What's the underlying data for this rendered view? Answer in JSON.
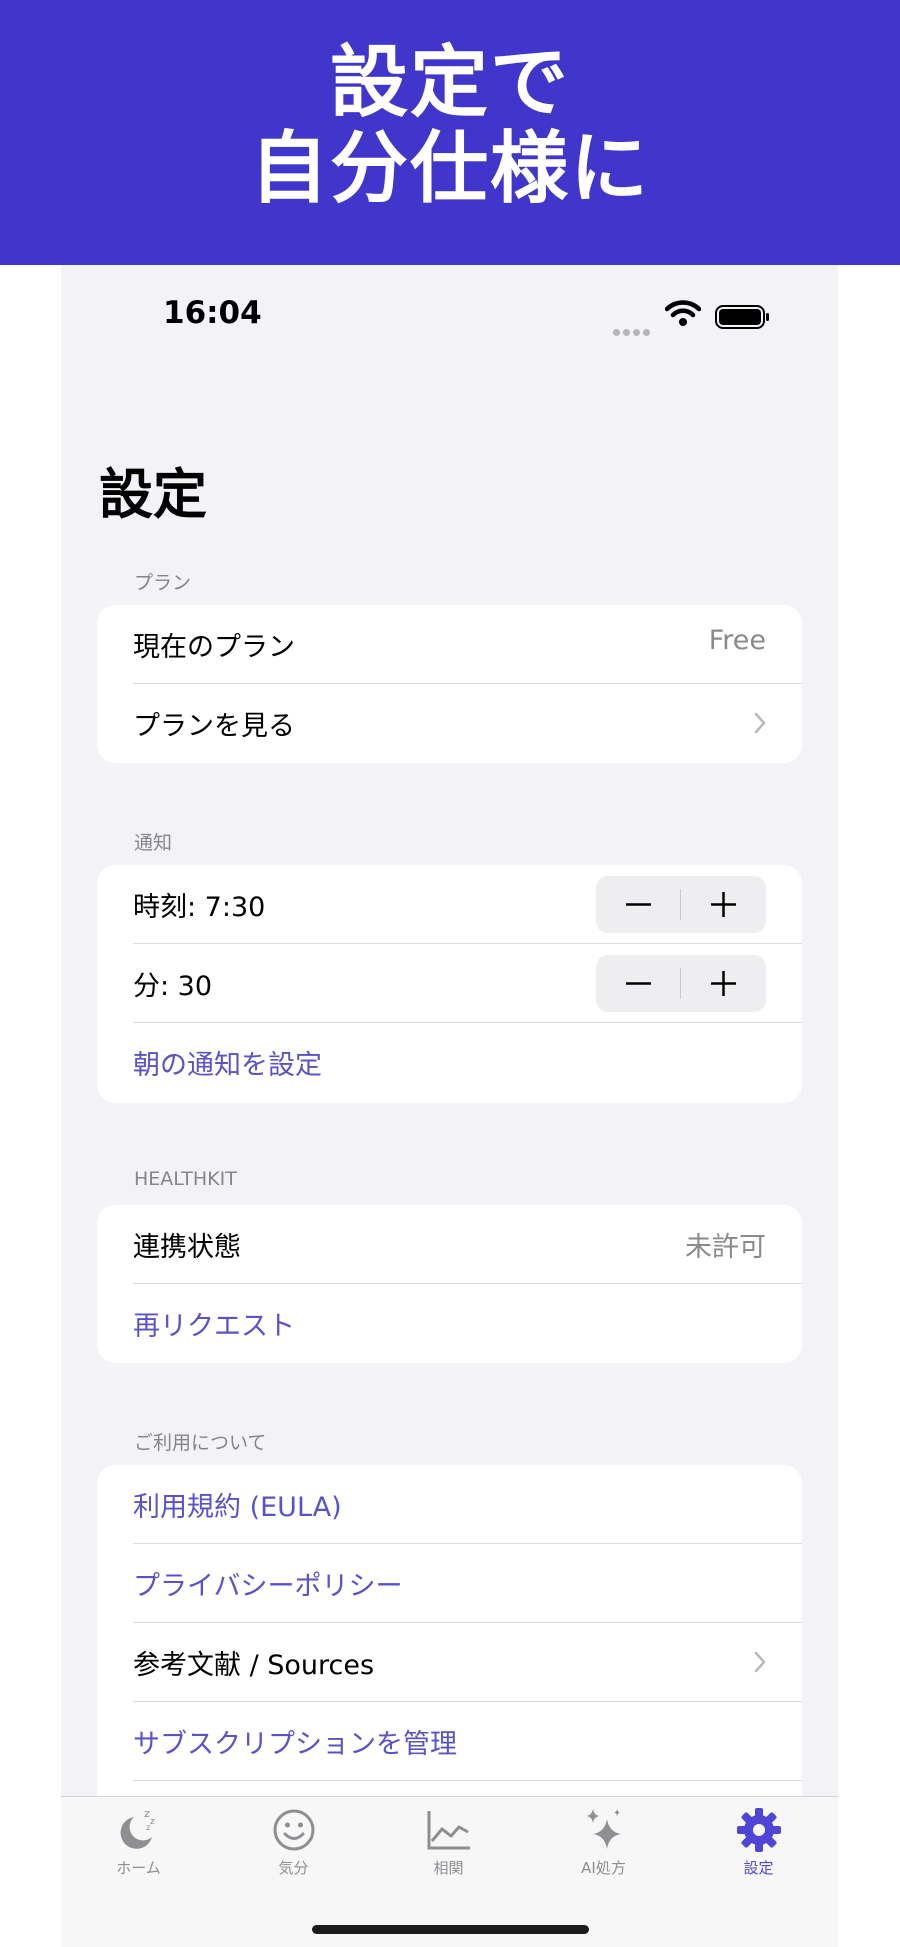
{
  "banner": {
    "line1": "設定で",
    "line2": "自分仕様に"
  },
  "status_bar": {
    "time": "16:04"
  },
  "page": {
    "title": "設定"
  },
  "sections": {
    "plan": {
      "header": "プラン",
      "current_plan_label": "現在のプラン",
      "current_plan_value": "Free",
      "view_plans_label": "プランを見る"
    },
    "notification": {
      "header": "通知",
      "time_label": "時刻: 7:30",
      "minute_label": "分: 30",
      "set_morning_label": "朝の通知を設定"
    },
    "healthkit": {
      "header": "HEALTHKIT",
      "status_label": "連携状態",
      "status_value": "未許可",
      "rerequest_label": "再リクエスト"
    },
    "about": {
      "header": "ご利用について",
      "eula_label": "利用規約 (EULA)",
      "privacy_label": "プライバシーポリシー",
      "sources_label": "参考文献 / Sources",
      "subscription_label": "サブスクリプションを管理"
    }
  },
  "tabbar": {
    "items": [
      {
        "label": "ホーム",
        "icon": "moon-zzz-icon"
      },
      {
        "label": "気分",
        "icon": "smiley-icon"
      },
      {
        "label": "相関",
        "icon": "line-chart-icon"
      },
      {
        "label": "AI処方",
        "icon": "sparkles-icon"
      },
      {
        "label": "設定",
        "icon": "gear-icon"
      }
    ],
    "active_index": 4
  },
  "colors": {
    "banner": "#4036cb",
    "accent": "#5a52c6",
    "active_tab": "#4f46d6",
    "background": "#f2f2f7"
  }
}
